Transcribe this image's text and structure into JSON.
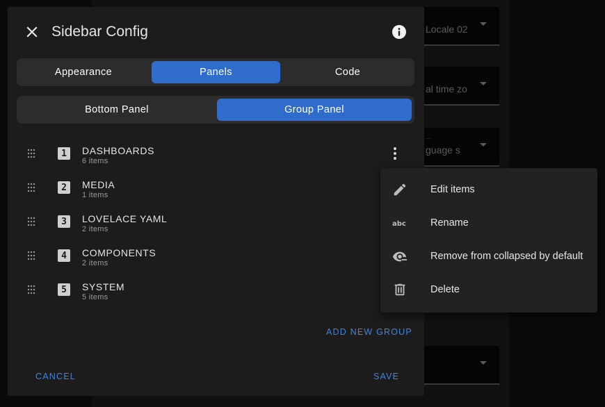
{
  "background": {
    "fields": [
      {
        "label": "",
        "value": "Locale 02"
      },
      {
        "label": "",
        "value": "al time zo"
      },
      {
        "label": "...",
        "value": "guage s"
      },
      {
        "label": "",
        "value": ""
      }
    ]
  },
  "dialog": {
    "title": "Sidebar Config",
    "close_icon": "close-icon",
    "info_icon": "info-icon",
    "tabs": [
      {
        "label": "Appearance",
        "active": false
      },
      {
        "label": "Panels",
        "active": true
      },
      {
        "label": "Code",
        "active": false
      }
    ],
    "subtabs": [
      {
        "label": "Bottom Panel",
        "active": false
      },
      {
        "label": "Group Panel",
        "active": true
      }
    ],
    "groups": [
      {
        "number": "1",
        "title": "DASHBOARDS",
        "subtitle": "6 items"
      },
      {
        "number": "2",
        "title": "MEDIA",
        "subtitle": "1 items"
      },
      {
        "number": "3",
        "title": "LOVELACE YAML",
        "subtitle": "2 items"
      },
      {
        "number": "4",
        "title": "COMPONENTS",
        "subtitle": "2 items"
      },
      {
        "number": "5",
        "title": "SYSTEM",
        "subtitle": "5 items"
      }
    ],
    "add_group_label": "ADD NEW GROUP",
    "cancel_label": "CANCEL",
    "save_label": "SAVE"
  },
  "menu": {
    "items": [
      {
        "label": "Edit items",
        "icon": "pencil-icon"
      },
      {
        "label": "Rename",
        "icon": "abc-icon"
      },
      {
        "label": "Remove from collapsed by default",
        "icon": "eye-minus-icon"
      },
      {
        "label": "Delete",
        "icon": "trash-icon"
      }
    ]
  },
  "colors": {
    "accent": "#2f6ccc",
    "link": "#3f86e0",
    "dialog_bg": "#1c1c1c",
    "menu_bg": "#222222"
  }
}
